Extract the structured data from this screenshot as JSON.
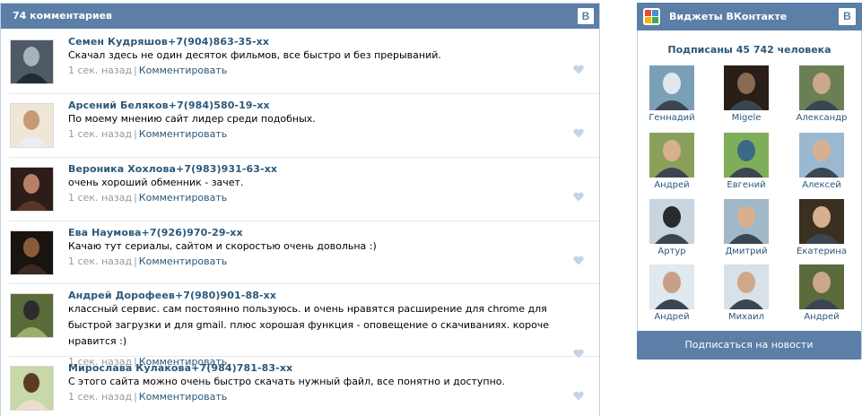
{
  "comments_widget": {
    "header": "74 комментариев",
    "badge": "B",
    "comments": [
      {
        "name": "Семен  Кудряшов+7(904)863-35-хх",
        "text": "Скачал здесь не один десяток фильмов, все быстро и без прерываний.",
        "time": "1 сек. назад",
        "separator": "|",
        "reply": "Комментировать"
      },
      {
        "name": "Арсений  Беляков+7(984)580-19-хх",
        "text": "По моему мнению сайт лидер среди подобных.",
        "time": "1 сек. назад",
        "separator": "|",
        "reply": "Комментировать"
      },
      {
        "name": "Вероника  Хохлова+7(983)931-63-хх",
        "text": "очень хороший обменник - зачет.",
        "time": "1 сек. назад",
        "separator": "|",
        "reply": "Комментировать"
      },
      {
        "name": "Ева  Наумова+7(926)970-29-хх",
        "text": "Качаю тут сериалы, сайтом и скоростью очень довольна :)",
        "time": "1 сек. назад",
        "separator": "|",
        "reply": "Комментировать"
      },
      {
        "name": "Андрей  Дорофеев+7(980)901-88-хх",
        "text": "классный сервис. сам постоянно пользуюсь. и очень нравятся расширение для chrome для быстрой загрузки и для gmail. плюс хорошая функция - оповещение о скачиваниях. короче нравится :)",
        "time": "1 сек. назад",
        "separator": "|",
        "reply": "Комментировать"
      },
      {
        "name": "Мирослава  Кулакова+7(984)781-83-хх",
        "text": "С этого сайта можно очень быстро скачать нужный файл, все понятно и доступно.",
        "time": "1 сек. назад",
        "separator": "|",
        "reply": "Комментировать"
      }
    ]
  },
  "vk_widget": {
    "title": "Виджеты ВКонтакте",
    "badge": "B",
    "subscribers": "Подписаны 45 742 человека",
    "members": [
      {
        "name": "Геннадий"
      },
      {
        "name": "Migele"
      },
      {
        "name": "Александр"
      },
      {
        "name": "Андрей"
      },
      {
        "name": "Евгений"
      },
      {
        "name": "Алексей"
      },
      {
        "name": "Артур"
      },
      {
        "name": "Дмитрий"
      },
      {
        "name": "Екатерина"
      },
      {
        "name": "Андрей"
      },
      {
        "name": "Михаил"
      },
      {
        "name": "Андрей"
      }
    ],
    "subscribe_button": "Подписаться на новости"
  },
  "colors": {
    "header_bg": "#5b7fa6",
    "link": "#2b587a",
    "meta": "#999999",
    "heart": "#c5d3e3"
  }
}
